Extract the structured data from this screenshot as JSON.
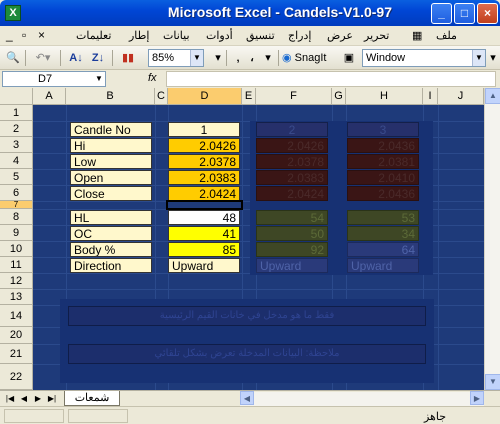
{
  "window": {
    "title": "Microsoft Excel - Candels-V1.0-97",
    "app_icon": "X",
    "controls": {
      "min": "_",
      "max": "□",
      "close": "×"
    }
  },
  "menu": {
    "items": [
      "ملف",
      "تحرير",
      "عرض",
      "إدراج",
      "تنسيق",
      "أدوات",
      "بيانات",
      "إطار",
      "تعليمات"
    ],
    "controls": {
      "min": "_",
      "restore": "▫",
      "close": "×"
    }
  },
  "toolbar": {
    "zoom": "85%",
    "snagit_label": "SnagIt",
    "window_label": "Window",
    "comma": "،",
    "decimal_icon": "‚"
  },
  "formula_bar": {
    "name_box": "D7",
    "fx": "fx",
    "content": ""
  },
  "columns": [
    "A",
    "B",
    "C",
    "D",
    "E",
    "F",
    "G",
    "H",
    "I",
    "J"
  ],
  "selected_column": "D",
  "rows": [
    "1",
    "2",
    "3",
    "4",
    "5",
    "6",
    "7",
    "8",
    "9",
    "10",
    "11",
    "12",
    "13",
    "14",
    "20",
    "21",
    "22"
  ],
  "labels": {
    "r2": "Candle No",
    "r3": "Hi",
    "r4": "Low",
    "r5": "Open",
    "r6": "Close",
    "r8": "HL",
    "r9": "OC",
    "r10": "Body %",
    "r11": "Direction"
  },
  "candle1": {
    "no": "1",
    "hi": "2.0426",
    "low": "2.0378",
    "open": "2.0383",
    "close": "2.0424",
    "hl": "48",
    "oc": "41",
    "body": "85",
    "direction": "Upward"
  },
  "candle2": {
    "no": "2",
    "hi": "2.0426",
    "low": "2.0378",
    "open": "2.0383",
    "close": "2.0424",
    "hl": "54",
    "oc": "50",
    "body": "92",
    "direction": "Upward"
  },
  "candle3": {
    "no": "3",
    "hi": "2.0436",
    "low": "2.0381",
    "open": "2.0410",
    "close": "2.0436",
    "hl": "53",
    "oc": "34",
    "body": "64",
    "direction": "Upward"
  },
  "notes": {
    "row14": "فقط ما هو مدخل في خانات القيم الرئيسية",
    "row20": "ملاحظة: البيانات المدخلة تعرض بشكل تلقائي"
  },
  "sheet_tab": "شمعات",
  "status": "جاهز"
}
